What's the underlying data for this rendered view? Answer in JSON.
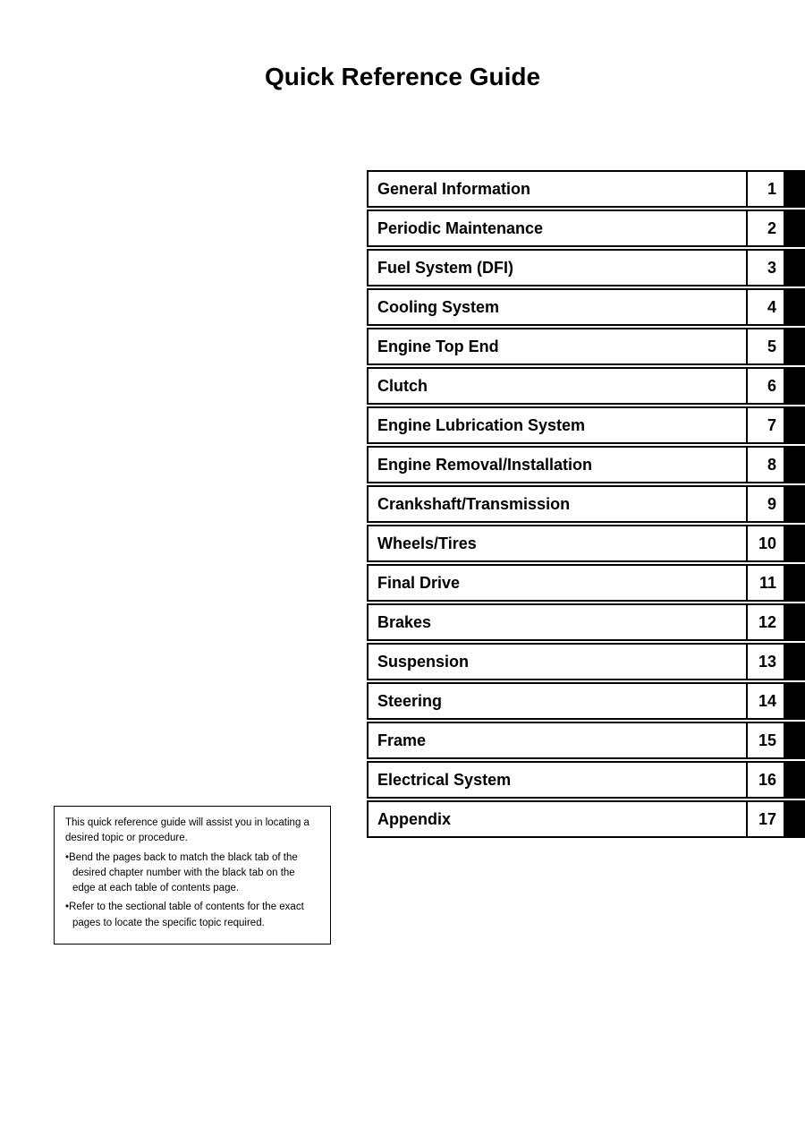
{
  "page": {
    "title": "Quick Reference Guide"
  },
  "toc": {
    "items": [
      {
        "label": "General Information",
        "number": "1"
      },
      {
        "label": "Periodic Maintenance",
        "number": "2"
      },
      {
        "label": "Fuel System (DFI)",
        "number": "3"
      },
      {
        "label": "Cooling System",
        "number": "4"
      },
      {
        "label": "Engine Top End",
        "number": "5"
      },
      {
        "label": "Clutch",
        "number": "6"
      },
      {
        "label": "Engine Lubrication System",
        "number": "7"
      },
      {
        "label": "Engine Removal/Installation",
        "number": "8"
      },
      {
        "label": "Crankshaft/Transmission",
        "number": "9"
      },
      {
        "label": "Wheels/Tires",
        "number": "10"
      },
      {
        "label": "Final Drive",
        "number": "11"
      },
      {
        "label": "Brakes",
        "number": "12"
      },
      {
        "label": "Suspension",
        "number": "13"
      },
      {
        "label": "Steering",
        "number": "14"
      },
      {
        "label": "Frame",
        "number": "15"
      },
      {
        "label": "Electrical System",
        "number": "16"
      },
      {
        "label": "Appendix",
        "number": "17"
      }
    ]
  },
  "note": {
    "intro": "This quick reference guide will assist you in locating a desired topic or procedure.",
    "bullet1": "Bend the pages back to match the black tab of the desired chapter number with the black tab on the edge at each table of contents page.",
    "bullet2": "Refer to the sectional table of contents for the exact pages to locate the specific topic required."
  }
}
